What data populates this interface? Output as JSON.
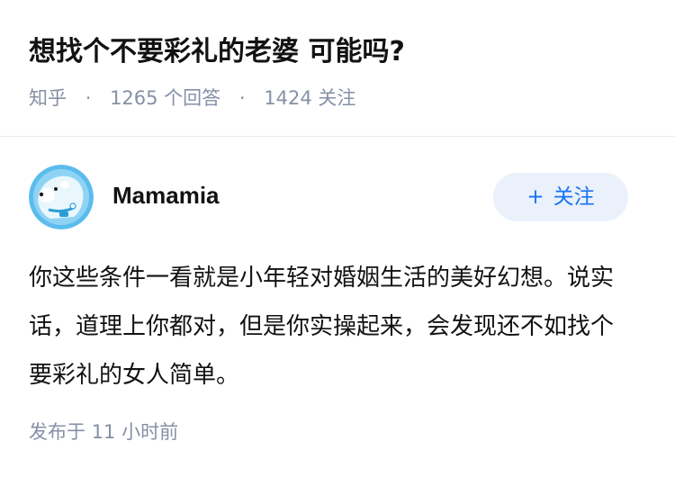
{
  "question": {
    "title": "想找个不要彩礼的老婆 可能吗?",
    "source": "知乎",
    "separator": "·",
    "answer_count": "1265 个回答",
    "follower_count": "1424 关注"
  },
  "answer": {
    "author": {
      "name": "Mamamia",
      "avatar_icon": "polar-bear-avatar-icon"
    },
    "follow_button": {
      "icon": "+",
      "label": "关注"
    },
    "content": "你这些条件一看就是小年轻对婚姻生活的美好幻想。说实话，道理上你都对，但是你实操起来，会发现还不如找个要彩礼的女人简单。",
    "time": "发布于 11 小时前"
  },
  "colors": {
    "title": "#121212",
    "meta": "#8590a6",
    "accent": "#1772f6",
    "button_bg": "#eaf1fb",
    "avatar_bg": "#5bbcec"
  }
}
